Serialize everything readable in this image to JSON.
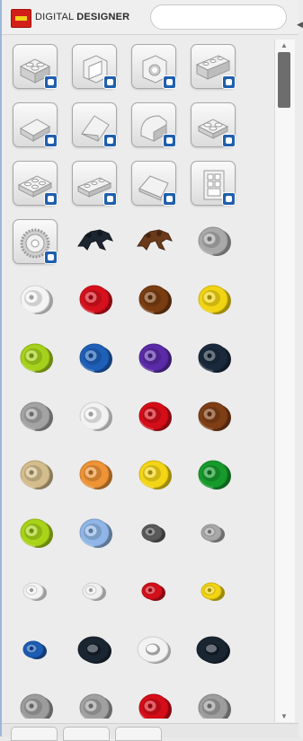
{
  "header": {
    "title_part1": "DIGITAL",
    "title_part2": "DESIGNER",
    "search_value": ""
  },
  "accent": "#d21f17",
  "add_badge_color": "#1f5fad",
  "grid": {
    "rows": [
      [
        {
          "kind": "tile",
          "icon": "brick-2x2-icon"
        },
        {
          "kind": "tile",
          "icon": "bracket-brick-icon"
        },
        {
          "kind": "tile",
          "icon": "technic-brick-icon"
        },
        {
          "kind": "tile",
          "icon": "brick-1x4-icon"
        }
      ],
      [
        {
          "kind": "tile",
          "icon": "slope-brick-icon"
        },
        {
          "kind": "tile",
          "icon": "wedge-brick-icon"
        },
        {
          "kind": "tile",
          "icon": "curved-brick-icon"
        },
        {
          "kind": "tile",
          "icon": "plate-2x2-icon"
        }
      ],
      [
        {
          "kind": "tile",
          "icon": "plate-2x3-icon"
        },
        {
          "kind": "tile",
          "icon": "plate-1x4-icon"
        },
        {
          "kind": "tile",
          "icon": "wing-plate-icon"
        },
        {
          "kind": "tile",
          "icon": "door-panel-icon"
        }
      ],
      [
        {
          "kind": "tile",
          "icon": "gear-wheel-icon"
        },
        {
          "kind": "part",
          "icon": "claw-black-icon",
          "color": "#1c2530"
        },
        {
          "kind": "part",
          "icon": "claw-brown-icon",
          "color": "#6b3a1a"
        },
        {
          "kind": "part",
          "icon": "wheel-hub-icon",
          "color": "#a9a9a9"
        }
      ],
      [
        {
          "kind": "part",
          "icon": "wheel-hub-icon",
          "color": "#f4f4f4"
        },
        {
          "kind": "part",
          "icon": "wheel-hub-icon",
          "color": "#d6101c"
        },
        {
          "kind": "part",
          "icon": "wheel-hub-icon",
          "color": "#7a3d12"
        },
        {
          "kind": "part",
          "icon": "wheel-hub-icon",
          "color": "#f1d412"
        }
      ],
      [
        {
          "kind": "part",
          "icon": "wheel-hub-icon",
          "color": "#a5d11c"
        },
        {
          "kind": "part",
          "icon": "wheel-hub-icon",
          "color": "#1e5fb8"
        },
        {
          "kind": "part",
          "icon": "wheel-hub-icon",
          "color": "#5a2aa7"
        },
        {
          "kind": "part",
          "icon": "wheel-hub-icon",
          "color": "#1a2a3c"
        }
      ],
      [
        {
          "kind": "part",
          "icon": "wheel-hub-icon",
          "color": "#a3a3a3"
        },
        {
          "kind": "part",
          "icon": "wheel-hub-icon",
          "color": "#f2f2f2"
        },
        {
          "kind": "part",
          "icon": "wheel-hub-icon",
          "color": "#d40d18"
        },
        {
          "kind": "part",
          "icon": "wheel-hub-icon",
          "color": "#7f3e15"
        }
      ],
      [
        {
          "kind": "part",
          "icon": "wheel-hub-icon",
          "color": "#d4bd8c"
        },
        {
          "kind": "part",
          "icon": "wheel-hub-icon",
          "color": "#ee9336"
        },
        {
          "kind": "part",
          "icon": "wheel-hub-icon",
          "color": "#f3d516"
        },
        {
          "kind": "part",
          "icon": "wheel-hub-icon",
          "color": "#179a2c"
        }
      ],
      [
        {
          "kind": "part",
          "icon": "wheel-hub-icon",
          "color": "#a8d318"
        },
        {
          "kind": "part",
          "icon": "wheel-hub-icon",
          "color": "#8fb6e6"
        },
        {
          "kind": "part",
          "icon": "small-hub-icon",
          "color": "#5a5a5a"
        },
        {
          "kind": "part",
          "icon": "small-hub-icon",
          "color": "#a8a8a8"
        }
      ],
      [
        {
          "kind": "part",
          "icon": "small-hub-icon",
          "color": "#f3f3f3"
        },
        {
          "kind": "part",
          "icon": "small-hub-icon",
          "color": "#f0f0f0"
        },
        {
          "kind": "part",
          "icon": "small-hub-icon",
          "color": "#d50f1a"
        },
        {
          "kind": "part",
          "icon": "small-hub-icon",
          "color": "#f2d413"
        }
      ],
      [
        {
          "kind": "part",
          "icon": "small-hub-icon",
          "color": "#1c5db6"
        },
        {
          "kind": "part",
          "icon": "tire-icon",
          "color": "#1a2532"
        },
        {
          "kind": "part",
          "icon": "tire-icon",
          "color": "#f2f2f2"
        },
        {
          "kind": "part",
          "icon": "tire-icon",
          "color": "#1a2532"
        }
      ],
      [
        {
          "kind": "part",
          "icon": "wheel-hub-icon",
          "color": "#9c9c9c"
        },
        {
          "kind": "part",
          "icon": "wheel-hub-icon",
          "color": "#a0a0a0"
        },
        {
          "kind": "part",
          "icon": "wheel-hub-icon",
          "color": "#d40d18"
        },
        {
          "kind": "part",
          "icon": "wheel-hub-icon",
          "color": "#9d9d9d"
        }
      ]
    ]
  }
}
